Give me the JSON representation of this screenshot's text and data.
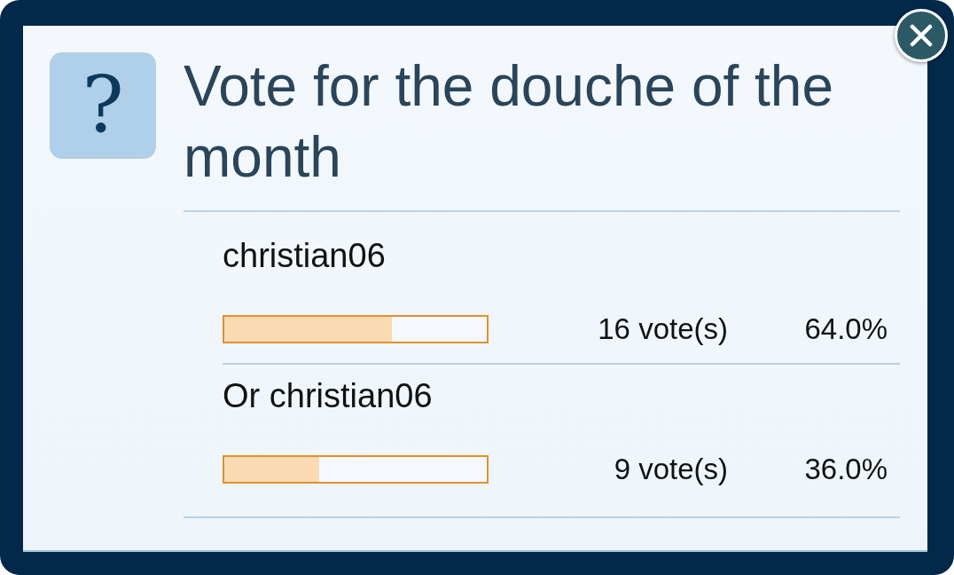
{
  "dialog": {
    "icon": "?",
    "title": "Vote for the douche of the month"
  },
  "options": [
    {
      "label": "christian06",
      "level": 0.64,
      "votes": "16 vote(s)",
      "percent": "64.0%"
    },
    {
      "label": "Or christian06",
      "level": 0.36,
      "votes": "9 vote(s)",
      "percent": "36.0%"
    }
  ]
}
